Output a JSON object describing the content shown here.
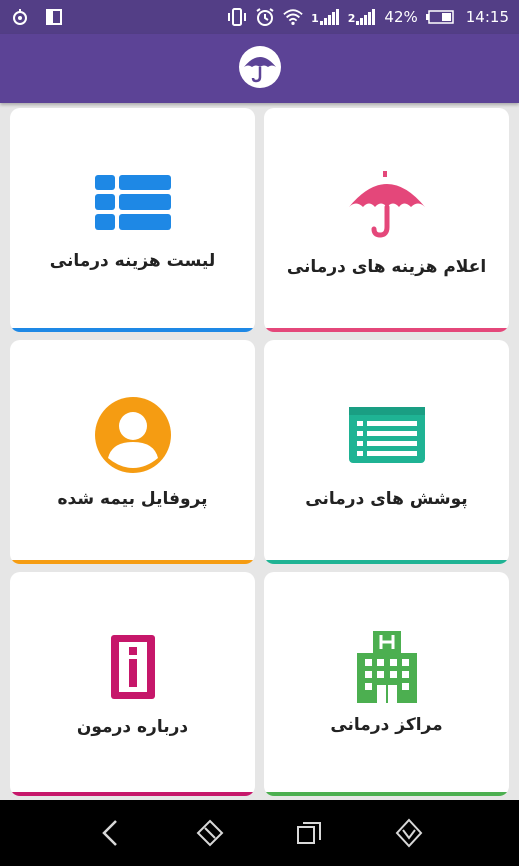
{
  "status_bar": {
    "battery_percent": "42%",
    "time": "14:15",
    "sim1_label": "1",
    "sim2_label": "2",
    "icons": [
      "notification-icon",
      "screen-icon",
      "vibrate-icon",
      "alarm-icon",
      "wifi-icon",
      "signal-icon",
      "battery-icon"
    ]
  },
  "app_bar": {
    "logo_icon": "umbrella-logo-icon"
  },
  "menu": [
    {
      "label": "اعلام هزینه های درمانی",
      "icon": "umbrella-icon",
      "color": "#e4477a"
    },
    {
      "label": "لیست هزینه درمانی",
      "icon": "list-icon",
      "color": "#1e88e5"
    },
    {
      "label": "پوشش های درمانی",
      "icon": "document-list-icon",
      "color": "#1fb394"
    },
    {
      "label": "پروفایل بیمه شده",
      "icon": "user-avatar-icon",
      "color": "#f59c12"
    },
    {
      "label": "مراکز درمانی",
      "icon": "hospital-icon",
      "color": "#4caf50"
    },
    {
      "label": "درباره درمون",
      "icon": "info-icon",
      "color": "#c6176a"
    }
  ],
  "nav_bar": {
    "icons": [
      "back-icon",
      "home-icon",
      "recents-icon",
      "assistant-icon"
    ]
  }
}
